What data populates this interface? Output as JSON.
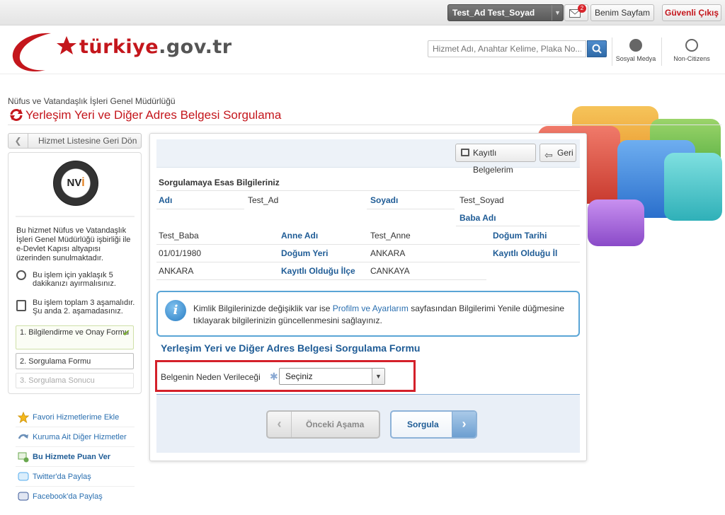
{
  "topbar": {
    "user_name": "Test_Ad Test_Soyad",
    "mail_count": "2",
    "my_page": "Benim Sayfam",
    "logout": "Güvenli Çıkış"
  },
  "header": {
    "logo_red": "türkiye",
    "logo_dark": ".gov.tr",
    "search_placeholder": "Hizmet Adı, Anahtar Kelime, Plaka No...",
    "social_label": "Sosyal Medya",
    "noncitizens_label": "Non-Citizens"
  },
  "page": {
    "org_name": "Nüfus ve Vatandaşlık İşleri Genel Müdürlüğü",
    "title": "Yerleşim Yeri ve Diğer Adres Belgesi Sorgulama"
  },
  "sidebar": {
    "back_button": "Hizmet Listesine Geri Dön",
    "logo_text_a": "NV",
    "logo_text_b": "İ",
    "description": "Bu hizmet Nüfus ve Vatandaşlık İşleri Genel Müdürlüğü işbirliği ile e-Devlet Kapısı altyapısı üzerinden sunulmaktadır.",
    "time_text": "Bu işlem için yaklaşık 5 dakikanızı ayırmalısınız.",
    "steps_text": "Bu işlem toplam 3 aşamalıdır. Şu anda 2. aşamadasınız.",
    "steps": [
      "1. Bilgilendirme ve Onay Formu",
      "2. Sorgulama Formu",
      "3. Sorgulama Sonucu"
    ],
    "links": [
      "Favori Hizmetlerime Ekle",
      "Kuruma Ait Diğer Hizmetler",
      "Bu Hizmete Puan Ver",
      "Twitter'da Paylaş",
      "Facebook'da Paylaş"
    ]
  },
  "main": {
    "toolbar": {
      "saved_docs": "Kayıtlı Belgelerim",
      "back": "Geri"
    },
    "info_heading": "Sorgulamaya Esas Bilgileriniz",
    "fields": {
      "ad_label": "Adı",
      "ad_value": "Test_Ad",
      "soyad_label": "Soyadı",
      "soyad_value": "Test_Soyad",
      "baba_label": "Baba Adı",
      "baba_value": "Test_Baba",
      "anne_label": "Anne Adı",
      "anne_value": "Test_Anne",
      "dogum_tarihi_label": "Doğum Tarihi",
      "dogum_tarihi_value": "01/01/1980",
      "dogum_yeri_label": "Doğum Yeri",
      "dogum_yeri_value": "ANKARA",
      "kayitli_il_label": "Kayıtlı Olduğu İl",
      "kayitli_il_value": "ANKARA",
      "kayitli_ilce_label": "Kayıtlı Olduğu İlçe",
      "kayitli_ilce_value": "CANKAYA"
    },
    "alert": {
      "text_before": "Kimlik Bilgilerinizde değişiklik var ise ",
      "link": "Profilm ve Ayarlarım",
      "text_after": " sayfasından Bilgilerimi Yenile düğmesine tıklayarak bilgilerinizin güncellenmesini sağlayınız."
    },
    "form_title": "Yerleşim Yeri ve Diğer Adres Belgesi Sorgulama Formu",
    "reason_label": "Belgenin Neden Verileceği",
    "reason_selected": "Seçiniz",
    "prev_button": "Önceki Aşama",
    "next_button": "Sorgula"
  },
  "colors": {
    "brand_red": "#c4161c",
    "link_blue": "#1f5c96"
  }
}
